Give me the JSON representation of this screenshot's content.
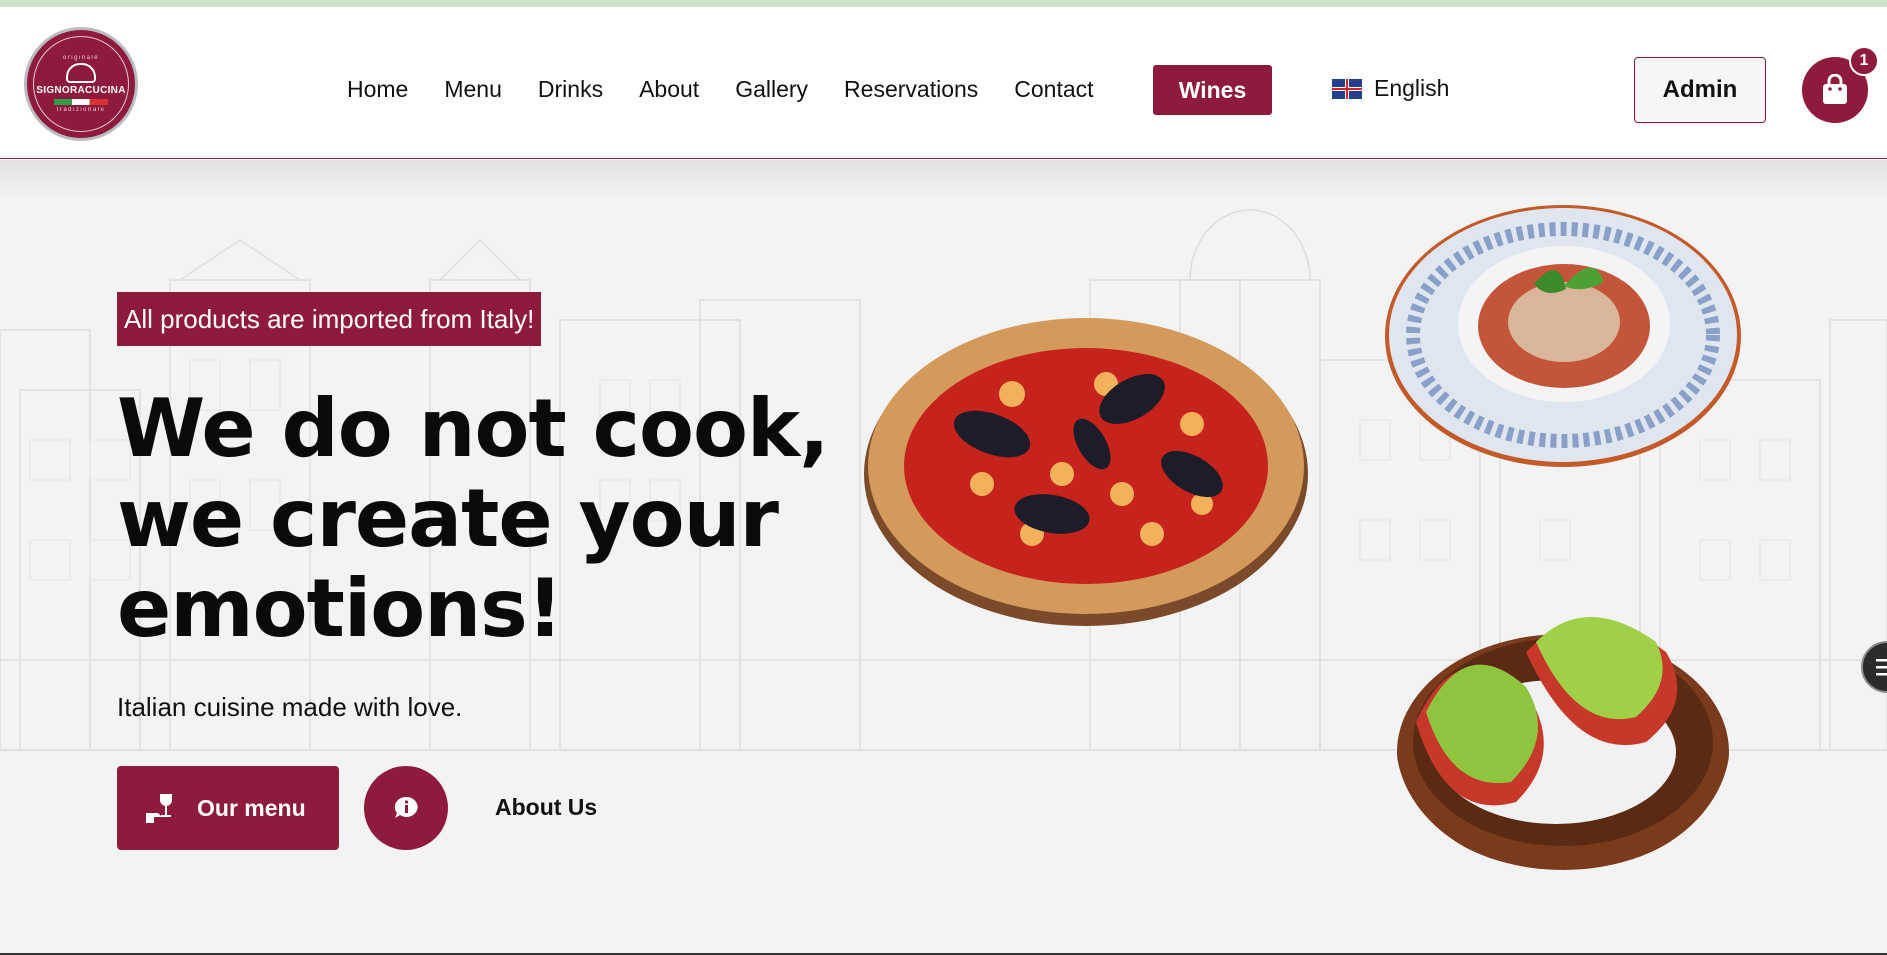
{
  "brand": {
    "name": "SIGNORACUCINA",
    "tagline_top": "originale",
    "tagline_bottom": "tradizionale"
  },
  "nav": {
    "items": [
      "Home",
      "Menu",
      "Drinks",
      "About",
      "Gallery",
      "Reservations",
      "Contact"
    ],
    "wines": "Wines"
  },
  "language": {
    "label": "English"
  },
  "admin": {
    "label": "Admin"
  },
  "cart": {
    "count": "1"
  },
  "hero": {
    "badge": "All products are imported from Italy!",
    "headline_1": "We do not cook,",
    "headline_2": "we create your",
    "headline_3": "emotions!",
    "subtitle": "Italian cuisine made with love.",
    "menu_button": "Our menu",
    "about_link": "About Us"
  },
  "colors": {
    "accent": "#8e1a3c",
    "text": "#111111"
  },
  "icons": [
    "shopping-bag-icon",
    "uk-flag-icon",
    "wine-glass-icon",
    "info-chat-icon",
    "chat-menu-icon"
  ]
}
